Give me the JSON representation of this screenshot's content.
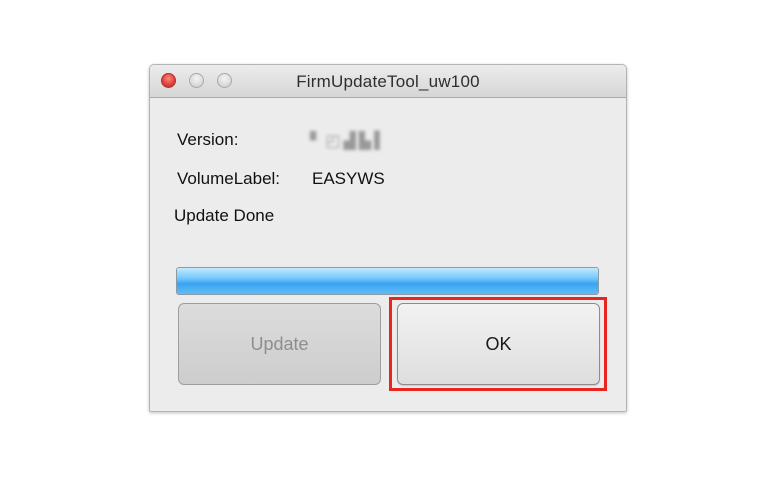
{
  "window": {
    "title": "FirmUpdateTool_uw100"
  },
  "fields": {
    "version_label": "Version:",
    "volume_label": "VolumeLabel:",
    "volume_value": "EASYWS"
  },
  "status": {
    "text": "Update Done"
  },
  "progress": {
    "percent": 100,
    "color": "#4bb3f5"
  },
  "buttons": {
    "update_label": "Update",
    "ok_label": "OK"
  },
  "annotation": {
    "highlight_color": "#e8261f"
  },
  "icons": {
    "close": "close-icon",
    "minimize": "minimize-icon",
    "zoom": "zoom-icon"
  }
}
